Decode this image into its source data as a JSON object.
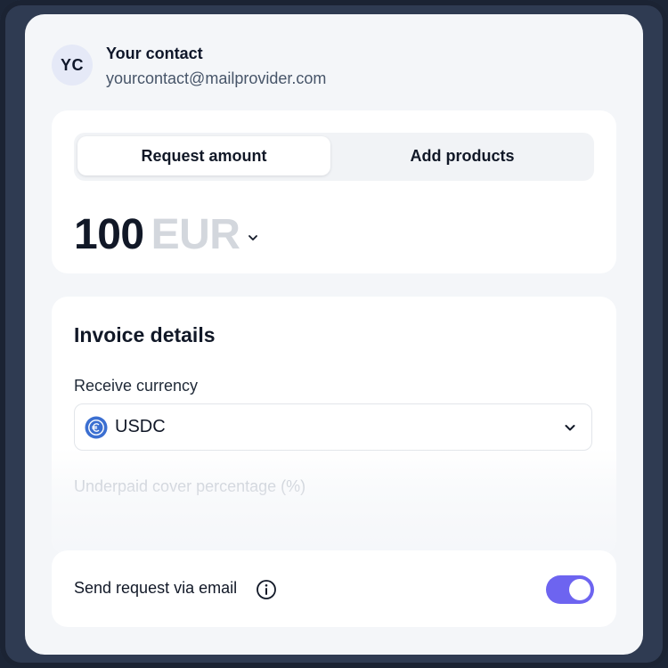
{
  "contact": {
    "initials": "YC",
    "name": "Your contact",
    "email": "yourcontact@mailprovider.com"
  },
  "amount_panel": {
    "tabs": [
      {
        "label": "Request amount",
        "active": true
      },
      {
        "label": "Add products",
        "active": false
      }
    ],
    "amount": "100",
    "currency": "EUR"
  },
  "invoice": {
    "title": "Invoice details",
    "receive_currency_label": "Receive currency",
    "receive_currency_value": "USDC",
    "receive_currency_icon": "usdc-coin-icon",
    "underpaid_label": "Underpaid cover percentage (%)"
  },
  "email_option": {
    "label": "Send request via email",
    "enabled": true
  },
  "colors": {
    "accent": "#6d64f0",
    "coin": "#3b6fd1",
    "background_frame": "#2f3b52"
  }
}
